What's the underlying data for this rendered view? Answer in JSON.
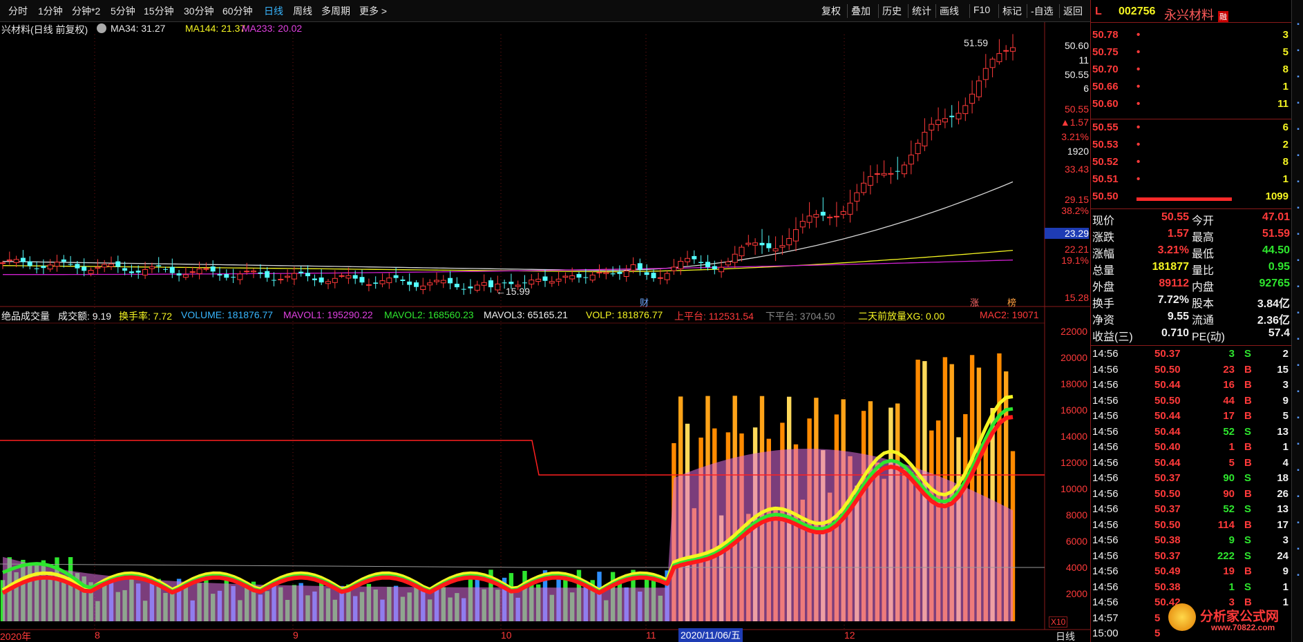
{
  "toolbar": {
    "left_items": [
      "分时",
      "1分钟",
      "分钟*2",
      "5分钟",
      "15分钟",
      "30分钟",
      "60分钟",
      "日线",
      "周线",
      "多周期",
      "更多 >"
    ],
    "active_item": "日线",
    "right_items": [
      "复权",
      "叠加",
      "历史",
      "统计",
      "画线",
      "F10",
      "标记",
      "-自选",
      "返回"
    ]
  },
  "price_panel": {
    "title": "兴材料(日线 前复权)",
    "ma_labels": [
      {
        "text": "MA34: 31.27",
        "color": "#e6e6e6"
      },
      {
        "text": "MA144: 21.37",
        "color": "#f5f522"
      },
      {
        "text": "MA233: 20.02",
        "color": "#e040e0"
      }
    ],
    "high_label": "51.59",
    "low_label": "15.99",
    "markers": {
      "cai": "财",
      "zhang": "涨",
      "bang": "榜"
    },
    "axis_right": [
      {
        "text": "50.60",
        "color": "#f0f0f0"
      },
      {
        "text": "11",
        "color": "#f0f0f0"
      },
      {
        "text": "50.55",
        "color": "#f0f0f0"
      },
      {
        "text": "6",
        "color": "#f0f0f0"
      },
      {
        "text": "50.55",
        "color": "#ff3a3a"
      },
      {
        "text": "▲1.57",
        "color": "#ff3a3a"
      },
      {
        "text": "3.21%",
        "color": "#ff3a3a"
      },
      {
        "text": "1920",
        "color": "#f0f0f0"
      },
      {
        "text": "33.43",
        "color": "#ff3a3a"
      },
      {
        "text": "29.15",
        "color": "#ff3a3a"
      },
      {
        "text": "38.2%",
        "color": "#ff3a3a"
      },
      {
        "text": "23.29",
        "color": "#ffffff"
      },
      {
        "text": "22.21",
        "color": "#ff3a3a"
      },
      {
        "text": "19.1%",
        "color": "#ff3a3a"
      },
      {
        "text": "15.28",
        "color": "#ff3a3a"
      }
    ]
  },
  "volume_panel": {
    "labels": [
      {
        "text": "绝品成交量",
        "color": "#f0f0f0"
      },
      {
        "text": "成交额: 9.19",
        "color": "#f0f0f0"
      },
      {
        "text": "换手率: 7.72",
        "color": "#f5f522"
      },
      {
        "text": "VOLUME: 181876.77",
        "color": "#38b6ff"
      },
      {
        "text": "MAVOL1: 195290.22",
        "color": "#e040e0"
      },
      {
        "text": "MAVOL2: 168560.23",
        "color": "#2ee62e"
      },
      {
        "text": "MAVOL3: 65165.21",
        "color": "#f0f0f0"
      },
      {
        "text": "VOLP: 181876.77",
        "color": "#f5f522"
      },
      {
        "text": "上平台: 112531.54",
        "color": "#ff3a3a"
      },
      {
        "text": "下平台: 3704.50",
        "color": "#888888"
      },
      {
        "text": "二天前放量XG: 0.00",
        "color": "#f5f522"
      },
      {
        "text": "MAC2: 19071",
        "color": "#ff3a3a"
      }
    ],
    "axis_right": [
      "22000",
      "20000",
      "18000",
      "16000",
      "14000",
      "12000",
      "10000",
      "8000",
      "6000",
      "4000",
      "2000"
    ],
    "unit": "X10"
  },
  "bottom_axis": {
    "labels": [
      "2020年",
      "8",
      "9",
      "10",
      "11",
      "12"
    ],
    "cursor_date": "2020/11/06/五",
    "period": "日线"
  },
  "chart_data": {
    "type": "candlestick",
    "title": "兴材料(日线 前复权)",
    "price_range": [
      15.28,
      51.59
    ],
    "high": 51.59,
    "low": 15.99,
    "ma": {
      "MA34": 31.27,
      "MA144": 21.37,
      "MA233": 20.02
    },
    "volume_range": [
      0,
      22000
    ],
    "volume_unit": "X10"
  },
  "side": {
    "code": "002756",
    "name": "永兴材料",
    "tag": "L",
    "badge": "融",
    "asks": [
      {
        "price": "50.78",
        "dot": "•",
        "vol": "3"
      },
      {
        "price": "50.75",
        "dot": "•",
        "vol": "5"
      },
      {
        "price": "50.70",
        "dot": "•",
        "vol": "8"
      },
      {
        "price": "50.66",
        "dot": "•",
        "vol": "1"
      },
      {
        "price": "50.60",
        "dot": "•",
        "vol": "11"
      }
    ],
    "bids": [
      {
        "price": "50.55",
        "dot": "•",
        "vol": "6"
      },
      {
        "price": "50.53",
        "dot": "•",
        "vol": "2"
      },
      {
        "price": "50.52",
        "dot": "•",
        "vol": "8"
      },
      {
        "price": "50.51",
        "dot": "•",
        "vol": "1"
      },
      {
        "price": "50.50",
        "dot": "",
        "vol": "1099"
      }
    ],
    "quote": [
      {
        "l1": "现价",
        "v1": "50.55",
        "c1": "red",
        "l2": "今开",
        "v2": "47.01",
        "c2": "red"
      },
      {
        "l1": "涨跌",
        "v1": "1.57",
        "c1": "red",
        "l2": "最高",
        "v2": "51.59",
        "c2": "red"
      },
      {
        "l1": "涨幅",
        "v1": "3.21%",
        "c1": "red",
        "l2": "最低",
        "v2": "44.50",
        "c2": "green"
      },
      {
        "l1": "总量",
        "v1": "181877",
        "c1": "yellow",
        "l2": "量比",
        "v2": "0.95",
        "c2": "green"
      },
      {
        "l1": "外盘",
        "v1": "89112",
        "c1": "red",
        "l2": "内盘",
        "v2": "92765",
        "c2": "green"
      },
      {
        "l1": "换手",
        "v1": "7.72%",
        "c1": "white",
        "l2": "股本",
        "v2": "3.84亿",
        "c2": "white"
      },
      {
        "l1": "净资",
        "v1": "9.55",
        "c1": "white",
        "l2": "流通",
        "v2": "2.36亿",
        "c2": "white"
      },
      {
        "l1": "收益(三)",
        "v1": "0.710",
        "c1": "white",
        "l2": "PE(动)",
        "v2": "57.4",
        "c2": "white"
      }
    ],
    "ticks": [
      {
        "t": "14:56",
        "p": "50.37",
        "v": "3",
        "s": "S",
        "n": "2"
      },
      {
        "t": "14:56",
        "p": "50.50",
        "v": "23",
        "s": "B",
        "n": "15"
      },
      {
        "t": "14:56",
        "p": "50.44",
        "v": "16",
        "s": "B",
        "n": "3"
      },
      {
        "t": "14:56",
        "p": "50.50",
        "v": "44",
        "s": "B",
        "n": "9"
      },
      {
        "t": "14:56",
        "p": "50.44",
        "v": "17",
        "s": "B",
        "n": "5"
      },
      {
        "t": "14:56",
        "p": "50.44",
        "v": "52",
        "s": "S",
        "n": "13"
      },
      {
        "t": "14:56",
        "p": "50.40",
        "v": "1",
        "s": "B",
        "n": "1"
      },
      {
        "t": "14:56",
        "p": "50.44",
        "v": "5",
        "s": "B",
        "n": "4"
      },
      {
        "t": "14:56",
        "p": "50.37",
        "v": "90",
        "s": "S",
        "n": "18"
      },
      {
        "t": "14:56",
        "p": "50.50",
        "v": "90",
        "s": "B",
        "n": "26"
      },
      {
        "t": "14:56",
        "p": "50.37",
        "v": "52",
        "s": "S",
        "n": "13"
      },
      {
        "t": "14:56",
        "p": "50.50",
        "v": "114",
        "s": "B",
        "n": "17"
      },
      {
        "t": "14:56",
        "p": "50.38",
        "v": "9",
        "s": "S",
        "n": "3"
      },
      {
        "t": "14:56",
        "p": "50.37",
        "v": "222",
        "s": "S",
        "n": "24"
      },
      {
        "t": "14:56",
        "p": "50.49",
        "v": "19",
        "s": "B",
        "n": "9"
      },
      {
        "t": "14:56",
        "p": "50.38",
        "v": "1",
        "s": "S",
        "n": "1"
      },
      {
        "t": "14:56",
        "p": "50.42",
        "v": "3",
        "s": "B",
        "n": "1"
      },
      {
        "t": "14:57",
        "p": "5",
        "v": "",
        "s": "",
        "n": ""
      },
      {
        "t": "15:00",
        "p": "5",
        "v": "",
        "s": "",
        "n": ""
      }
    ],
    "watermark": {
      "brand": "分析家公式网",
      "url": "www.70822.com"
    }
  }
}
